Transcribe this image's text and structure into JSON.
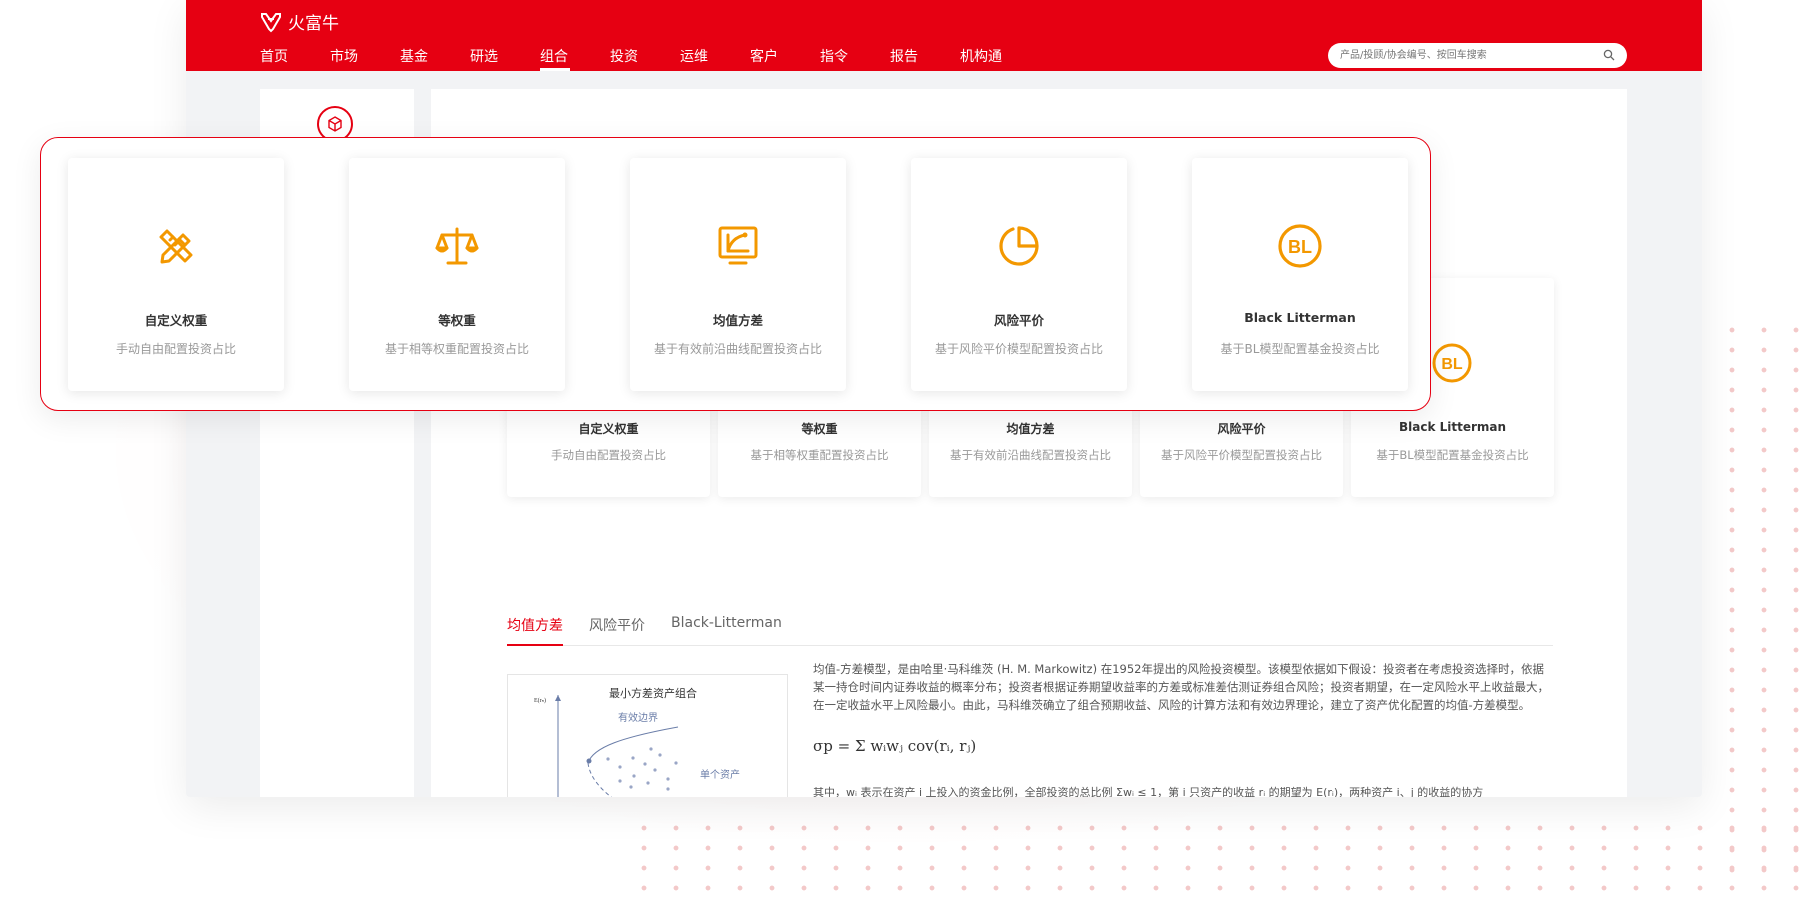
{
  "header": {
    "brand": "火富牛",
    "nav": [
      "首页",
      "市场",
      "基金",
      "研选",
      "组合",
      "投资",
      "运维",
      "客户",
      "指令",
      "报告",
      "机构通"
    ],
    "active_nav": "组合",
    "search_placeholder": "产品/投顾/协会编号、按回车搜索"
  },
  "overlay_cards": [
    {
      "title": "自定义权重",
      "desc": "手动自由配置投资占比",
      "icon": "pencil-ruler-icon"
    },
    {
      "title": "等权重",
      "desc": "基于相等权重配置投资占比",
      "icon": "balance-scale-icon"
    },
    {
      "title": "均值方差",
      "desc": "基于有效前沿曲线配置投资占比",
      "icon": "chart-monitor-icon"
    },
    {
      "title": "风险平价",
      "desc": "基于风险平价模型配置投资占比",
      "icon": "pie-chart-icon"
    },
    {
      "title": "Black Litterman",
      "desc": "基于BL模型配置基金投资占比",
      "icon": "bl-badge-icon"
    }
  ],
  "background_cards": [
    {
      "title": "自定义权重",
      "desc": "手动自由配置投资占比"
    },
    {
      "title": "等权重",
      "desc": "基于相等权重配置投资占比"
    },
    {
      "title": "均值方差",
      "desc": "基于有效前沿曲线配置投资占比"
    },
    {
      "title": "风险平价",
      "desc": "基于风险平价模型配置投资占比"
    },
    {
      "title": "Black Litterman",
      "desc": "基于BL模型配置基金投资占比"
    }
  ],
  "tabs": [
    "均值方差",
    "风险平价",
    "Black-Litterman"
  ],
  "active_tab": "均值方差",
  "figure": {
    "title": "最小方差资产组合",
    "ylabel": "E(rₙ)",
    "frontier_label": "有效边界",
    "asset_label": "单个资产"
  },
  "description": "均值-方差模型，是由哈里·马科维茨 (H. M. Markowitz) 在1952年提出的风险投资模型。该模型依据如下假设：投资者在考虑投资选择时，依据某一持仓时间内证券收益的概率分布；投资者根据证券期望收益率的方差或标准差估测证券组合风险；投资者期望，在一定风险水平上收益最大，在一定收益水平上风险最小。由此，马科维茨确立了组合预期收益、风险的计算方法和有效边界理论，建立了资产优化配置的均值-方差模型。",
  "formula": "σp = Σ wᵢwⱼ cov(rᵢ, rⱼ)",
  "formula_note": "其中，wᵢ 表示在资产 i 上投入的资金比例，全部投资的总比例 Σwᵢ ≤ 1，第 i 只资产的收益 rᵢ 的期望为 E(rᵢ)，两种资产 i、j 的收益的协方",
  "colors": {
    "brand": "#e60012",
    "accent": "#f39800"
  }
}
